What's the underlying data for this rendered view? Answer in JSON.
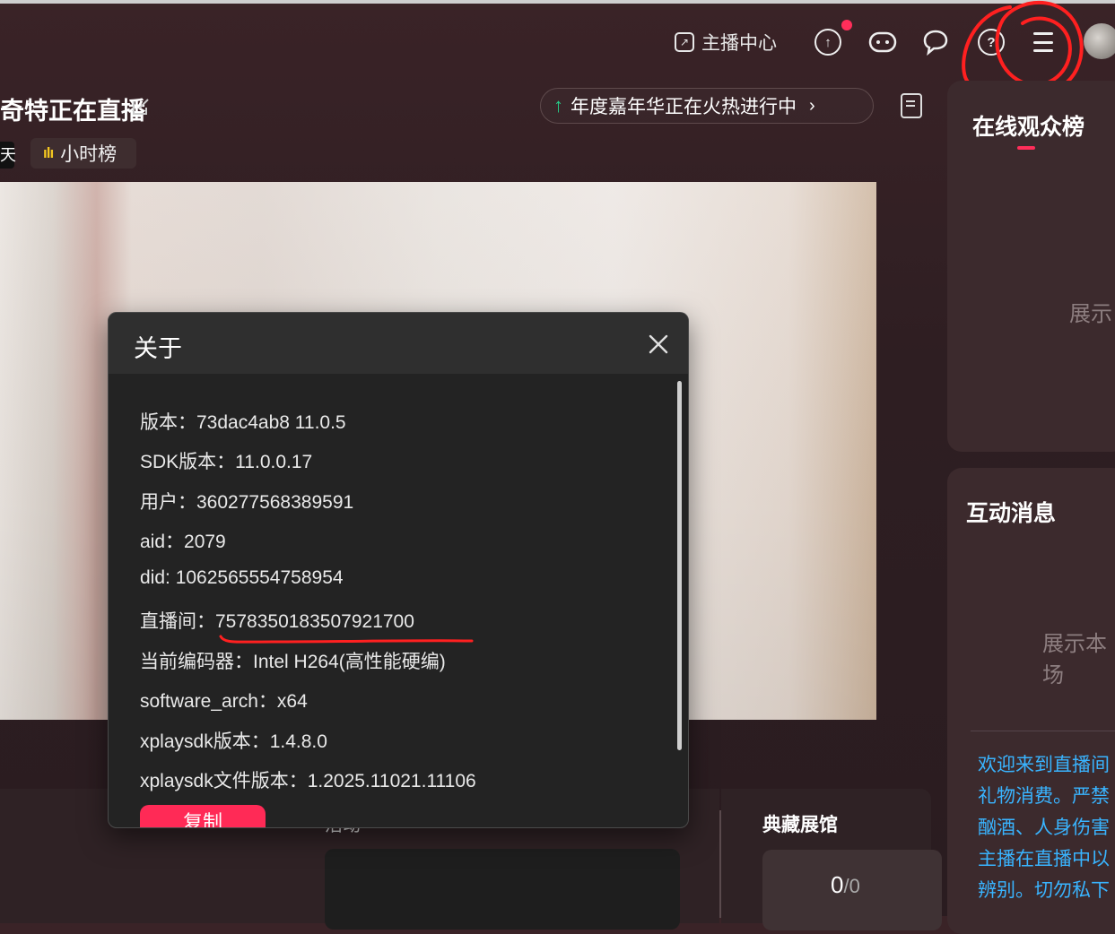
{
  "header": {
    "studio_label": "主播中心"
  },
  "stream": {
    "title": "奇特正在直播",
    "tag_left": "天",
    "hour_rank_label": "小时榜",
    "banner_text": "年度嘉年华正在火热进行中"
  },
  "right_panel": {
    "viewers_title": "在线观众榜",
    "viewers_placeholder": "展示",
    "interaction_title": "互动消息",
    "interaction_placeholder": "展示本场",
    "welcome_lines": [
      "欢迎来到直播间",
      "礼物消费。严禁",
      "酗酒、人身伤害",
      "主播在直播中以",
      "辨别。切勿私下"
    ]
  },
  "bottom": {
    "mid_label": "活动",
    "collection_title": "典藏展馆",
    "collection_count": "0",
    "collection_total": "/0"
  },
  "about_dialog": {
    "title": "关于",
    "lines": [
      "版本：73dac4ab8 11.0.5",
      "SDK版本：11.0.0.17",
      "用户：360277568389591",
      "aid：2079",
      "did: 1062565554758954",
      "直播间：7578350183507921700",
      "当前编码器：Intel H264(高性能硬编)",
      "software_arch：x64",
      "xplaysdk版本：1.4.8.0",
      "xplaysdk文件版本：1.2025.11021.11106"
    ],
    "copy_label": "复制"
  },
  "colors": {
    "accent": "#ff2a56",
    "link_blue": "#39b4ff",
    "annotation_red": "#ff2020"
  }
}
